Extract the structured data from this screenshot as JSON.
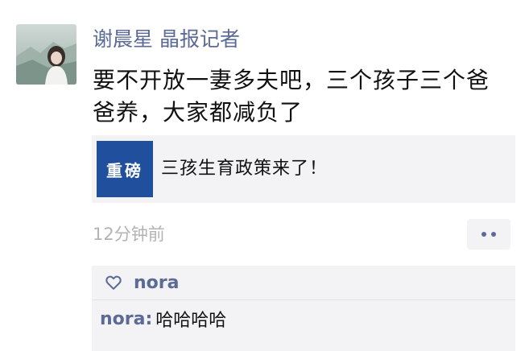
{
  "post": {
    "author": "谢晨星 晶报记者",
    "content": "要不开放一妻多夫吧，三个孩子三个爸爸养，大家都减负了",
    "share": {
      "thumb_text": "重磅",
      "title": "三孩生育政策来了！",
      "thumb_color": "#1f4f9d"
    },
    "time": "12分钟前"
  },
  "interactions": {
    "likes": [
      {
        "name": "nora"
      }
    ],
    "comments": [
      {
        "user": "nora",
        "sep": ": ",
        "text": "哈哈哈哈"
      }
    ]
  },
  "colors": {
    "name_blue": "#5b6b95",
    "panel_bg": "#f3f3f5",
    "time_gray": "#b3b3b3"
  },
  "icons": {
    "like": "heart-outline-icon",
    "more": "two-dots-icon"
  }
}
